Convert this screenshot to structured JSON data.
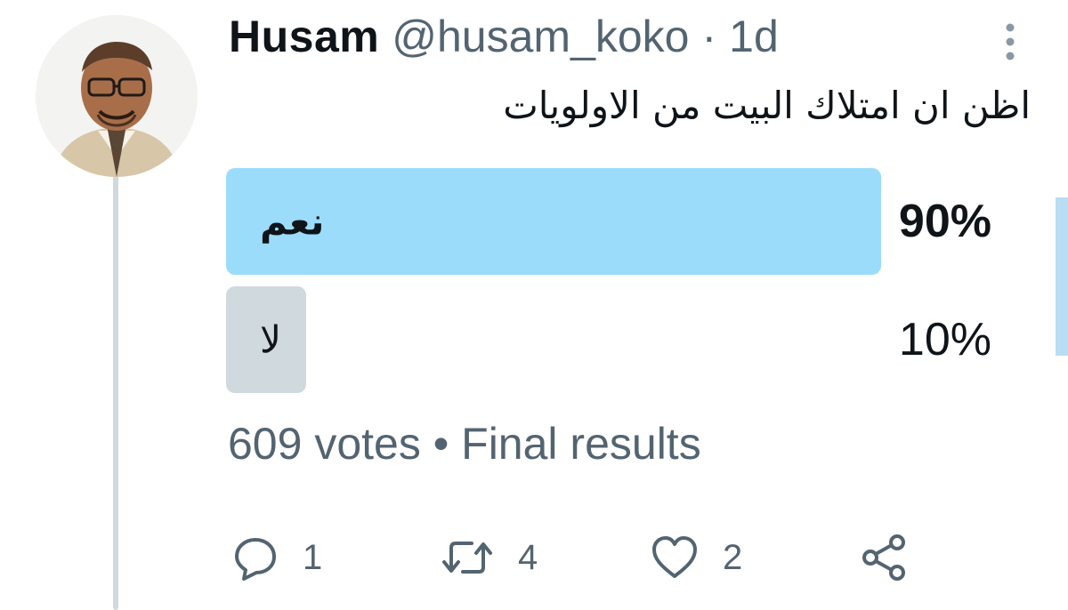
{
  "tweet": {
    "display_name": "Husam",
    "handle": "@husam_koko",
    "separator": "·",
    "time": "1d",
    "text": "اظن ان امتلاك البيت من الاولويات"
  },
  "poll": {
    "options": [
      {
        "label": "نعم",
        "percent_text": "90%",
        "share": 0.9,
        "winner": true,
        "fill_color": "#9bdcfb"
      },
      {
        "label": "لا",
        "percent_text": "10%",
        "share": 0.1,
        "winner": false,
        "fill_color": "#cfd9de"
      }
    ],
    "votes": "609 votes",
    "meta_separator": "•",
    "status": "Final results"
  },
  "actions": {
    "reply_count": "1",
    "retweet_count": "4",
    "like_count": "2"
  },
  "icons": [
    "more-icon",
    "reply-icon",
    "retweet-icon",
    "like-icon",
    "share-icon"
  ],
  "colors": {
    "text_primary": "#0f1419",
    "text_secondary": "#536471",
    "poll_winner": "#9bdcfb",
    "poll_other": "#cfd9de"
  }
}
